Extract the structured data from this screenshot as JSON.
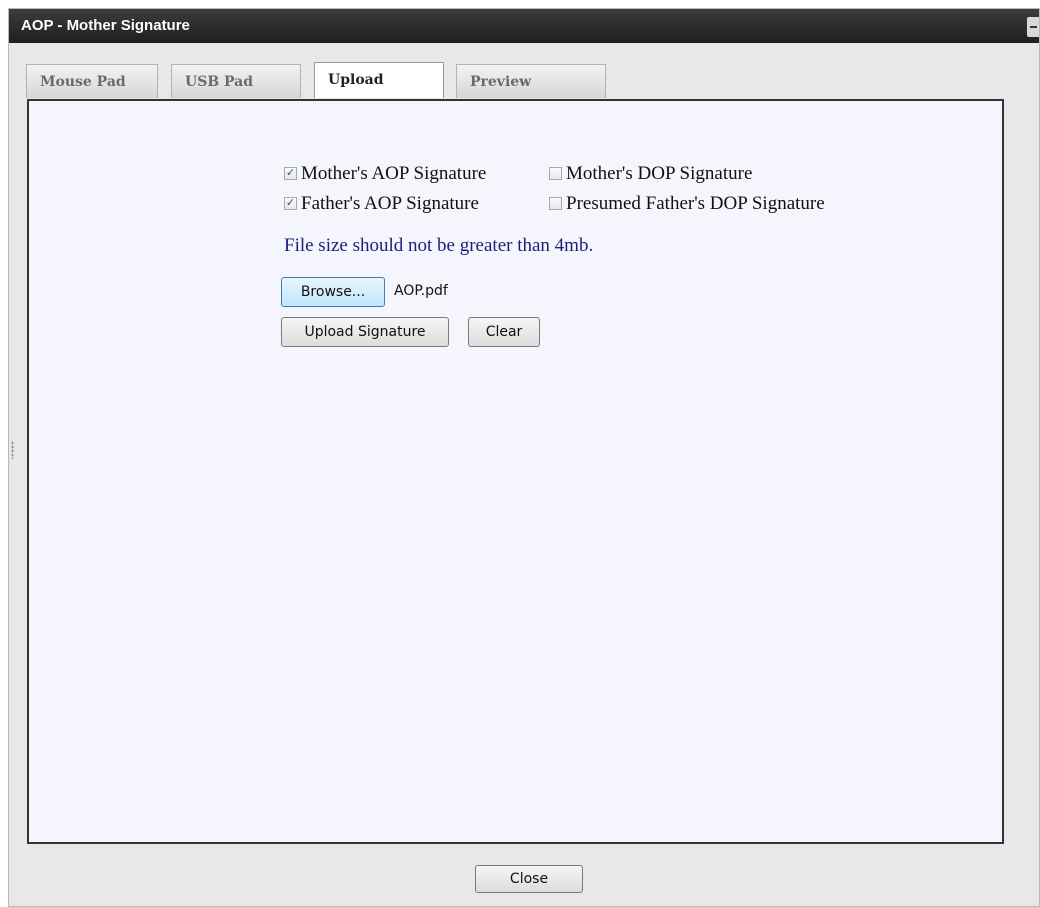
{
  "window": {
    "title": "AOP - Mother Signature"
  },
  "tabs": [
    {
      "label": "Mouse Pad",
      "active": false
    },
    {
      "label": "USB Pad",
      "active": false
    },
    {
      "label": "Upload",
      "active": true
    },
    {
      "label": "Preview",
      "active": false
    }
  ],
  "checkboxes": {
    "mother_aop": {
      "label": "Mother's AOP Signature",
      "checked": true
    },
    "mother_dop": {
      "label": "Mother's DOP Signature",
      "checked": false
    },
    "father_aop": {
      "label": "Father's AOP Signature",
      "checked": true
    },
    "presumed_father_dop": {
      "label": "Presumed Father's DOP Signature",
      "checked": false
    }
  },
  "note": "File size should not be greater than 4mb.",
  "file": {
    "browse_label": "Browse...",
    "filename": "AOP.pdf"
  },
  "actions": {
    "upload_label": "Upload Signature",
    "clear_label": "Clear"
  },
  "footer": {
    "close_label": "Close"
  },
  "check_glyph": "✓",
  "colors": {
    "titlebar": "#2b2b2b",
    "panel_bg": "#f4f5fd",
    "note_text": "#1d1d7a"
  }
}
